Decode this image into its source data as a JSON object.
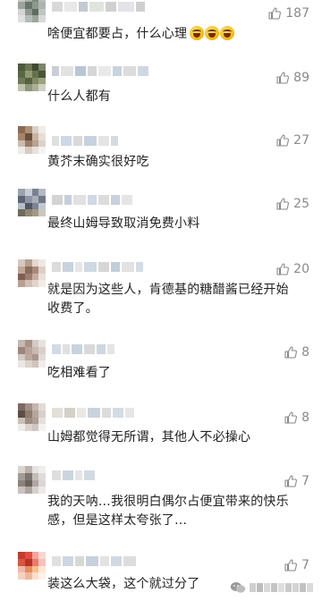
{
  "comments": [
    {
      "text": "啥便宜都要占，什么心理",
      "likes": "187",
      "emojis": [
        "laughing-tears-emoji",
        "laughing-tears-emoji",
        "laughing-tears-emoji"
      ]
    },
    {
      "text": "什么人都有",
      "likes": "89"
    },
    {
      "text": "黄芥末确实很好吃",
      "likes": "27"
    },
    {
      "text": "最终山姆导致取消免费小料",
      "likes": "25"
    },
    {
      "text": "就是因为这些人，肯德基的糖醋酱已经开始收费了。",
      "likes": "20"
    },
    {
      "text": "吃相难看了",
      "likes": "8"
    },
    {
      "text": "山姆都觉得无所谓，其他人不必操心",
      "likes": "8"
    },
    {
      "text": "我的天呐…我很明白偶尔占便宜带来的快乐感，但是这样太夸张了…",
      "likes": "7"
    },
    {
      "text": "装这么大袋，这个就过分了",
      "likes": "7"
    }
  ],
  "icons": {
    "like": "thumbs-up-icon",
    "watermark": "wechat-icon"
  },
  "colors": {
    "text": "#222222",
    "like_count": "#8a8a8a",
    "background": "#ffffff"
  }
}
